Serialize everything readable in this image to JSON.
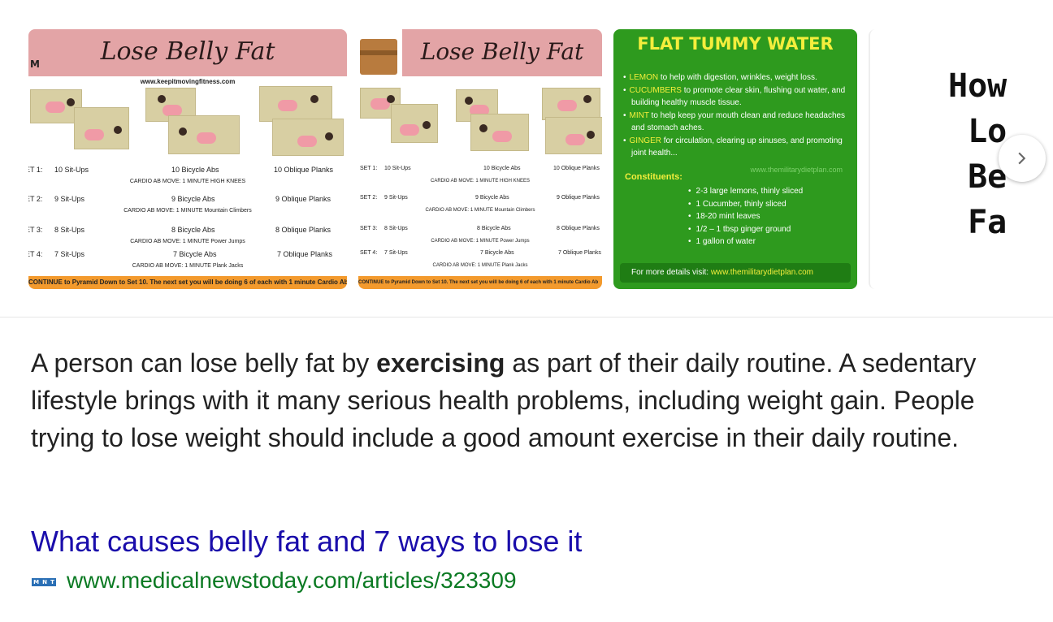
{
  "carousel": {
    "poster": {
      "title": "Lose Belly Fat",
      "logo": "M",
      "url": "www.keepitmovingfitness.com",
      "sets": [
        {
          "label": "SET 1:",
          "sit": "10 Sit-Ups",
          "bike": "10 Bicycle Abs",
          "oblique": "10 Oblique Planks",
          "cardio": "CARDIO AB MOVE: 1 MINUTE  HIGH KNEES"
        },
        {
          "label": "SET 2:",
          "sit": "9 Sit-Ups",
          "bike": "9 Bicycle Abs",
          "oblique": "9 Oblique Planks",
          "cardio": "CARDIO AB MOVE: 1 MINUTE  Mountain Climbers"
        },
        {
          "label": "SET 3:",
          "sit": "8 Sit-Ups",
          "bike": "8 Bicycle Abs",
          "oblique": "8 Oblique Planks",
          "cardio": "CARDIO AB MOVE: 1 MINUTE  Power Jumps"
        },
        {
          "label": "SET 4:",
          "sit": "7 Sit-Ups",
          "bike": "7 Bicycle Abs",
          "oblique": "7 Oblique Planks",
          "cardio": "CARDIO AB MOVE: 1 MINUTE  Plank Jacks"
        }
      ],
      "footer": "CONTINUE to Pyramid Down to Set 10. The next set you will be doing 6 of each with 1 minute Cardio Ab"
    },
    "flat_tummy": {
      "title": "FLAT TUMMY WATER",
      "benefits": [
        {
          "kw": "LEMON",
          "text": " to help with digestion, wrinkles, weight loss."
        },
        {
          "kw": "CUCUMBERS",
          "text": " to promote clear skin, flushing out water, and building healthy muscle tissue."
        },
        {
          "kw": "MINT",
          "text": " to help keep your mouth clean and reduce headaches and stomach aches."
        },
        {
          "kw": "GINGER",
          "text": " for circulation, clearing up sinuses, and promoting joint health..."
        }
      ],
      "site": "www.themilitarydietplan.com",
      "constituents_label": "Constituents:",
      "constituents": [
        "2-3 large lemons, thinly sliced",
        "1 Cucumber, thinly sliced",
        "18-20 mint leaves",
        "1/2 – 1 tbsp ginger ground",
        "1 gallon of water"
      ],
      "footer_label": "For more details visit: ",
      "footer_link": "www.themilitarydietplan.com"
    },
    "how_to": {
      "lines": [
        "How",
        "Lo",
        "Be",
        "Fa"
      ]
    },
    "next_icon": "chevron-right-icon"
  },
  "snippet": {
    "before": "A person can lose belly fat by ",
    "bold": "exercising",
    "after": " as part of their daily routine. A sedentary lifestyle brings with it many serious health problems, including weight gain. People trying to lose weight should include a good amount exercise in their daily routine."
  },
  "result": {
    "title": "What causes belly fat and 7 ways to lose it",
    "favicon_letters": [
      "M",
      "N",
      "T"
    ],
    "url": "www.medicalnewstoday.com/articles/323309"
  },
  "colors": {
    "link": "#1a0dab",
    "url": "#0b7a23"
  }
}
